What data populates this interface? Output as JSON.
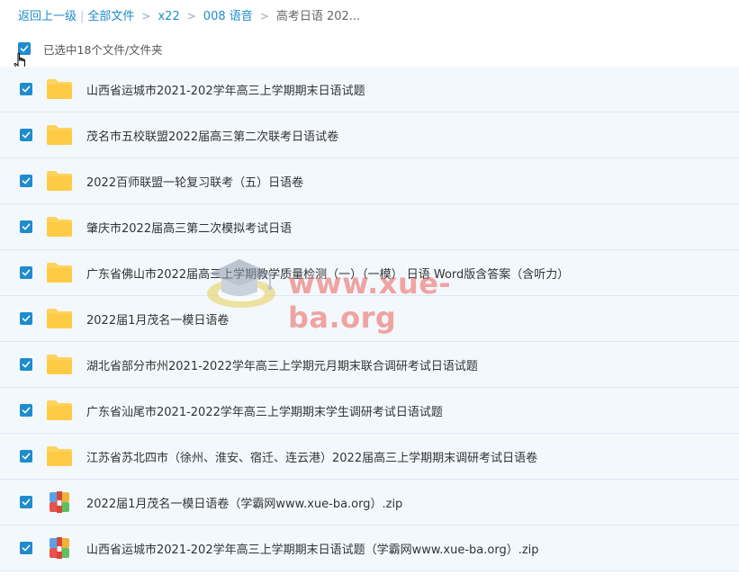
{
  "breadcrumb": {
    "back": "返回上一级",
    "all_files": "全部文件",
    "items": [
      "x22",
      "008 语音"
    ],
    "current": "高考日语 202..."
  },
  "selection": {
    "label": "已选中18个文件/文件夹"
  },
  "files": [
    {
      "type": "folder",
      "name": "山西省运城市2021-202学年高三上学期期末日语试题"
    },
    {
      "type": "folder",
      "name": "茂名市五校联盟2022届高三第二次联考日语试卷"
    },
    {
      "type": "folder",
      "name": "2022百师联盟一轮复习联考（五）日语卷"
    },
    {
      "type": "folder",
      "name": "肇庆市2022届高三第二次模拟考试日语"
    },
    {
      "type": "folder",
      "name": "广东省佛山市2022届高三上学期教学质量检测（一）（一模） 日语 Word版含答案（含听力）"
    },
    {
      "type": "folder",
      "name": "2022届1月茂名一模日语卷"
    },
    {
      "type": "folder",
      "name": "湖北省部分市州2021-2022学年高三上学期元月期末联合调研考试日语试题"
    },
    {
      "type": "folder",
      "name": "广东省汕尾市2021-2022学年高三上学期期末学生调研考试日语试题"
    },
    {
      "type": "folder",
      "name": "江苏省苏北四市（徐州、淮安、宿迁、连云港）2022届高三上学期期末调研考试日语卷"
    },
    {
      "type": "zip",
      "name": "2022届1月茂名一模日语卷（学霸网www.xue-ba.org）.zip"
    },
    {
      "type": "zip",
      "name": "山西省运城市2021-202学年高三上学期期末日语试题（学霸网www.xue-ba.org）.zip"
    }
  ],
  "watermark": {
    "text": "www.xue-ba.org"
  },
  "colors": {
    "accent": "#1f8ccc",
    "row_bg": "#f3f8fd",
    "folder": "#ffd25c"
  }
}
